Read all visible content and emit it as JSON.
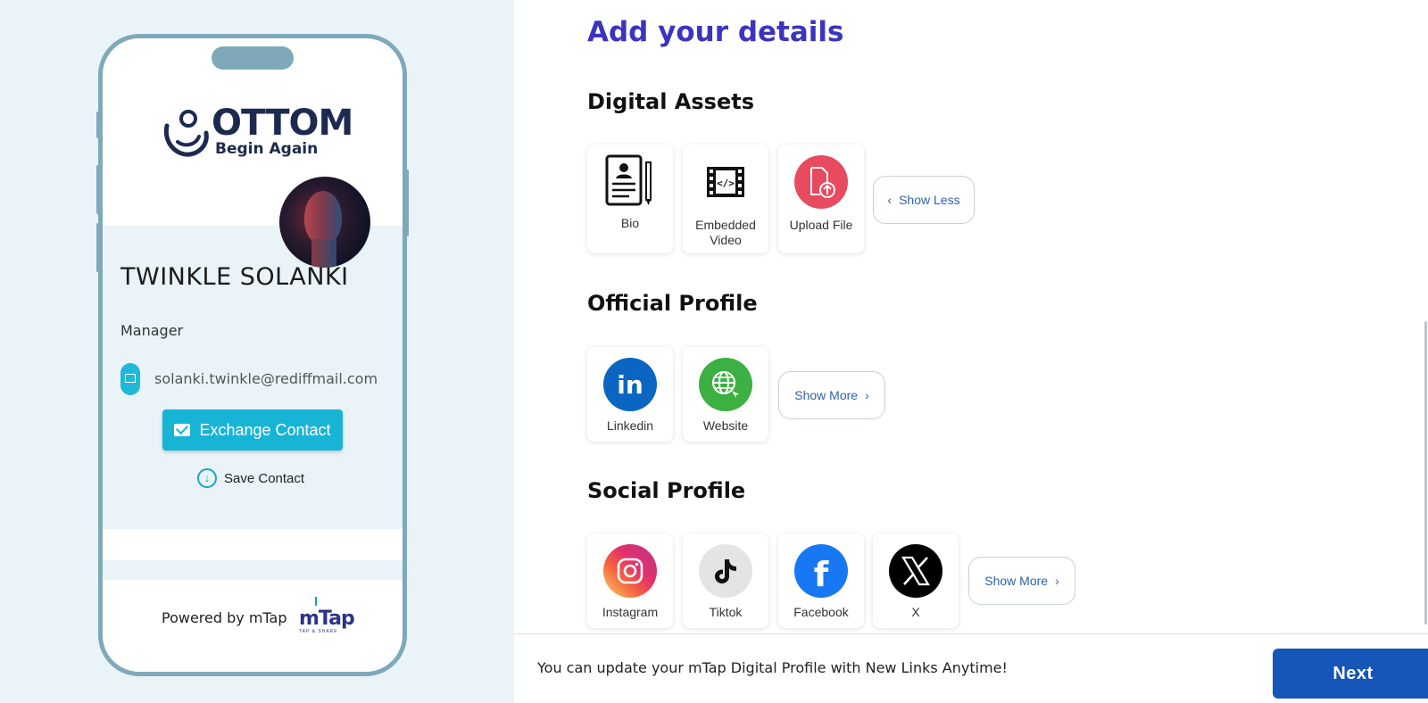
{
  "preview": {
    "logo_text": "OTTOM",
    "logo_subtitle": "Begin Again",
    "name": "TWINKLE SOLANKI",
    "role": "Manager",
    "email": "solanki.twinkle@rediffmail.com",
    "exchange_label": "Exchange Contact",
    "save_label": "Save Contact",
    "powered_by": "Powered by mTap",
    "mtap_logo": "mTap",
    "mtap_tagline": "TAP & SHARE"
  },
  "form": {
    "heading": "Add your details",
    "sections": {
      "digital_assets": {
        "title": "Digital Assets",
        "items": [
          {
            "label": "Bio",
            "icon": "bio-icon"
          },
          {
            "label": "Embedded Video",
            "icon": "embedded-video-icon"
          },
          {
            "label": "Upload File",
            "icon": "upload-file-icon",
            "color": "#e84a5f"
          }
        ],
        "toggle": "Show Less"
      },
      "official_profile": {
        "title": "Official Profile",
        "items": [
          {
            "label": "Linkedin",
            "icon": "linkedin-icon",
            "color": "#0a66c2"
          },
          {
            "label": "Website",
            "icon": "website-icon",
            "color": "#3cb043"
          }
        ],
        "toggle": "Show More"
      },
      "social_profile": {
        "title": "Social Profile",
        "items": [
          {
            "label": "Instagram",
            "icon": "instagram-icon"
          },
          {
            "label": "Tiktok",
            "icon": "tiktok-icon"
          },
          {
            "label": "Facebook",
            "icon": "facebook-icon",
            "color": "#1877f2"
          },
          {
            "label": "X",
            "icon": "x-icon",
            "color": "#000000"
          }
        ],
        "toggle": "Show More"
      }
    }
  },
  "footer": {
    "message": "You can update your mTap Digital Profile with New Links Anytime!",
    "next_label": "Next"
  },
  "colors": {
    "accent": "#3b35bd",
    "primary_button": "#1556b8",
    "exchange_button": "#17b4d6"
  }
}
